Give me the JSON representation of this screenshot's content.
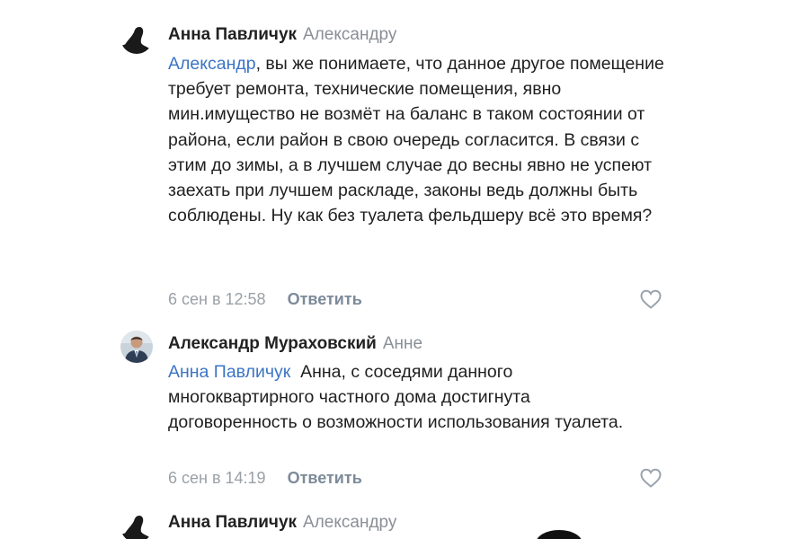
{
  "comments": [
    {
      "author": "Анна Павличук",
      "reply_to": "Александру",
      "mention": "Александр",
      "text": ", вы же понимаете, что данное другое помещение требует ремонта, технические помещения, явно мин.имущество не возмёт на баланс в таком состоянии от района, если район в свою очередь согласится. В связи с этим до зимы, а в лучшем случае до весны явно не успеют заехать при лучшем раскладе, законы ведь должны быть соблюдены. Ну как без туалета фельдшеру всё это время?",
      "timestamp": "6 сен в 12:58",
      "reply_label": "Ответить",
      "avatar_icon": "woman-silhouette-avatar",
      "like_icon": "heart-icon"
    },
    {
      "author": "Александр Мураховский",
      "reply_to": "Анне",
      "mention": "Анна Павличук",
      "text": "  Анна, с соседями данного многоквартирного частного дома достигнута договоренность о возможности использования туалета.",
      "timestamp": "6 сен в 14:19",
      "reply_label": "Ответить",
      "avatar_icon": "man-in-suit-avatar",
      "like_icon": "heart-icon"
    },
    {
      "author": "Анна Павличук",
      "reply_to": "Александру",
      "avatar_icon": "woman-silhouette-avatar"
    }
  ],
  "colors": {
    "mention": "#3b74c4",
    "secondary_text": "#8a8f96",
    "reply_link": "#7d8a99",
    "body_text": "#1f1f1f"
  }
}
